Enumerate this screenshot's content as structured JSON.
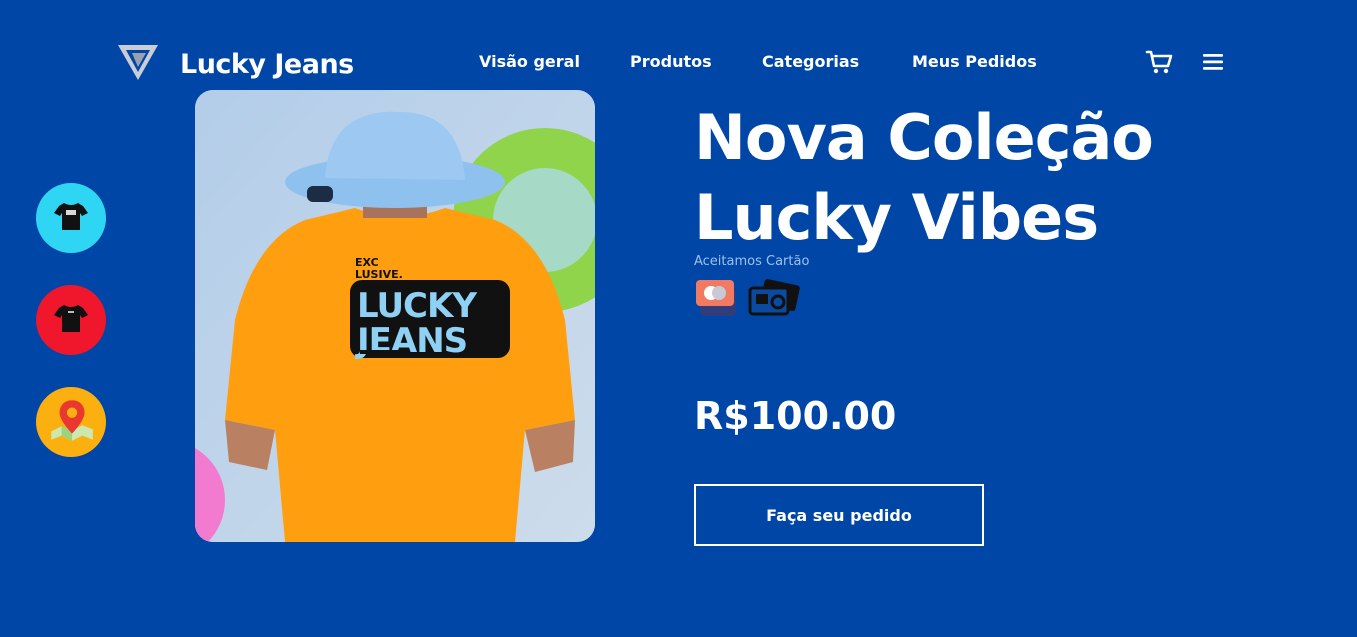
{
  "header": {
    "brand": "Lucky Jeans",
    "nav": [
      {
        "label": "Visão geral"
      },
      {
        "label": "Produtos"
      },
      {
        "label": "Categorias"
      },
      {
        "label": "Meus Pedidos"
      }
    ],
    "icons": [
      "logo-icon",
      "cart-icon",
      "menu-icon"
    ]
  },
  "sidebar": {
    "items": [
      {
        "icon": "black-tshirt-icon",
        "color": "#2fd6f3"
      },
      {
        "icon": "black-tshirt-icon",
        "color": "#f0162b"
      },
      {
        "icon": "map-pin-icon",
        "color": "#fcb010"
      }
    ]
  },
  "hero": {
    "title_line1": "Nova Coleção",
    "title_line2": "Lucky Vibes",
    "payment_note": "Aceitamos Cartão",
    "payment_icons": [
      "credit-card-icon",
      "cards-stack-icon"
    ],
    "price": "R$100.00",
    "cta": "Faça seu pedido",
    "image": {
      "subject": "person-in-orange-tshirt-photo",
      "shirt_print_top": "EXC LUSIVE.",
      "shirt_print_main": "LUCKY JEANS"
    }
  },
  "colors": {
    "background": "#0046a6",
    "accent_orange": "#ff9f10",
    "text": "#ffffff"
  }
}
